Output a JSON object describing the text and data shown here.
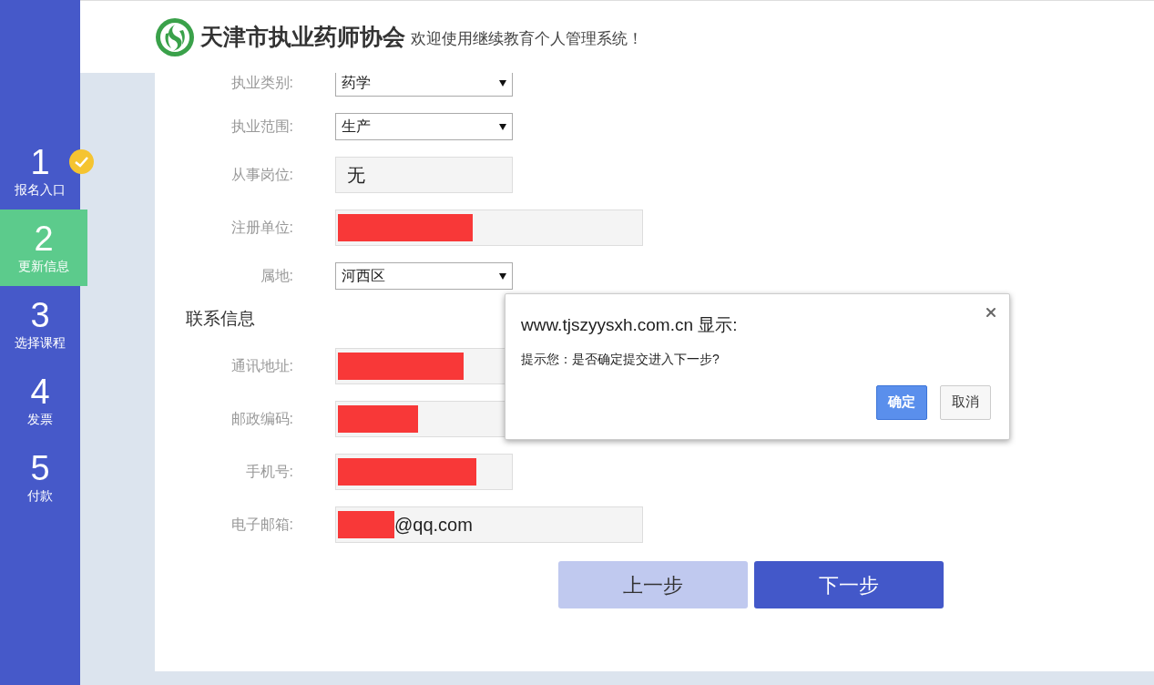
{
  "steps": [
    {
      "number": "1",
      "label": "报名入口",
      "selected": false,
      "done": true
    },
    {
      "number": "2",
      "label": "更新信息",
      "selected": true,
      "done": false
    },
    {
      "number": "3",
      "label": "选择课程",
      "selected": false,
      "done": false
    },
    {
      "number": "4",
      "label": "发票",
      "selected": false,
      "done": false
    },
    {
      "number": "5",
      "label": "付款",
      "selected": false,
      "done": false
    }
  ],
  "header": {
    "org_name": "天津市执业药师协会",
    "welcome": "欢迎使用继续教育个人管理系统！"
  },
  "form": [
    {
      "kind": "select",
      "label": "执业类别:",
      "value": "药学"
    },
    {
      "kind": "select",
      "label": "执业范围:",
      "value": "生产"
    },
    {
      "kind": "text",
      "label": "从事岗位:",
      "value": "无",
      "redacted": false
    },
    {
      "kind": "wide_text",
      "label": "注册单位:",
      "redacted": true
    },
    {
      "kind": "select",
      "label": "属地:",
      "value": "河西区"
    },
    {
      "kind": "heading",
      "label": "联系信息"
    },
    {
      "kind": "text",
      "label": "通讯地址:",
      "redacted": true
    },
    {
      "kind": "text",
      "label": "邮政编码:",
      "redacted": true
    },
    {
      "kind": "text",
      "label": "手机号:",
      "redacted": true
    },
    {
      "kind": "wide_text",
      "label": "电子邮箱:",
      "value": "@qq.com",
      "redacted": true
    }
  ],
  "buttons": [
    {
      "label": "上一步",
      "kind": "secondary"
    },
    {
      "label": "下一步",
      "kind": "primary"
    }
  ],
  "dialog": {
    "title": "www.tjszyysxh.com.cn 显示:",
    "message": "提示您：是否确定提交进入下一步?",
    "buttons": [
      {
        "label": "确定",
        "kind": "primary"
      },
      {
        "label": "取消",
        "kind": "secondary"
      }
    ]
  }
}
